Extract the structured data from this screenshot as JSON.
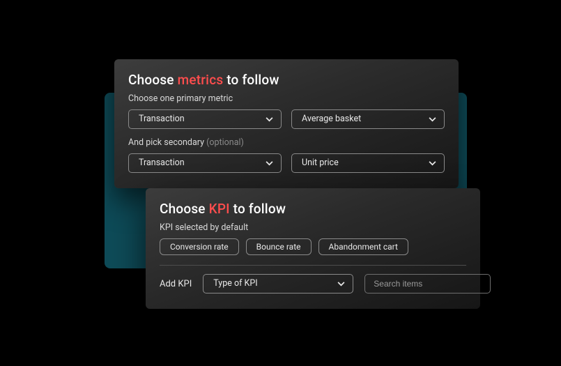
{
  "colors": {
    "accent": "#ff4d4d",
    "teal": "#0e4b58"
  },
  "metrics": {
    "title_pre": "Choose ",
    "title_accent": "metrics",
    "title_post": " to follow",
    "primary_label": "Choose one primary metric",
    "primary_select1": "Transaction",
    "primary_select2": "Average basket",
    "secondary_label_main": "And pick secondary ",
    "secondary_label_optional": "(optional)",
    "secondary_select1": "Transaction",
    "secondary_select2": "Unit price"
  },
  "kpi": {
    "title_pre": "Choose ",
    "title_accent": "KPI",
    "title_post": " to follow",
    "default_label": "KPI selected by default",
    "chips": {
      "conversion": "Conversion rate",
      "bounce": "Bounce rate",
      "abandonment": "Abandonment cart"
    },
    "add_label": "Add KPI",
    "type_select": "Type of KPI",
    "search_placeholder": "Search items"
  }
}
